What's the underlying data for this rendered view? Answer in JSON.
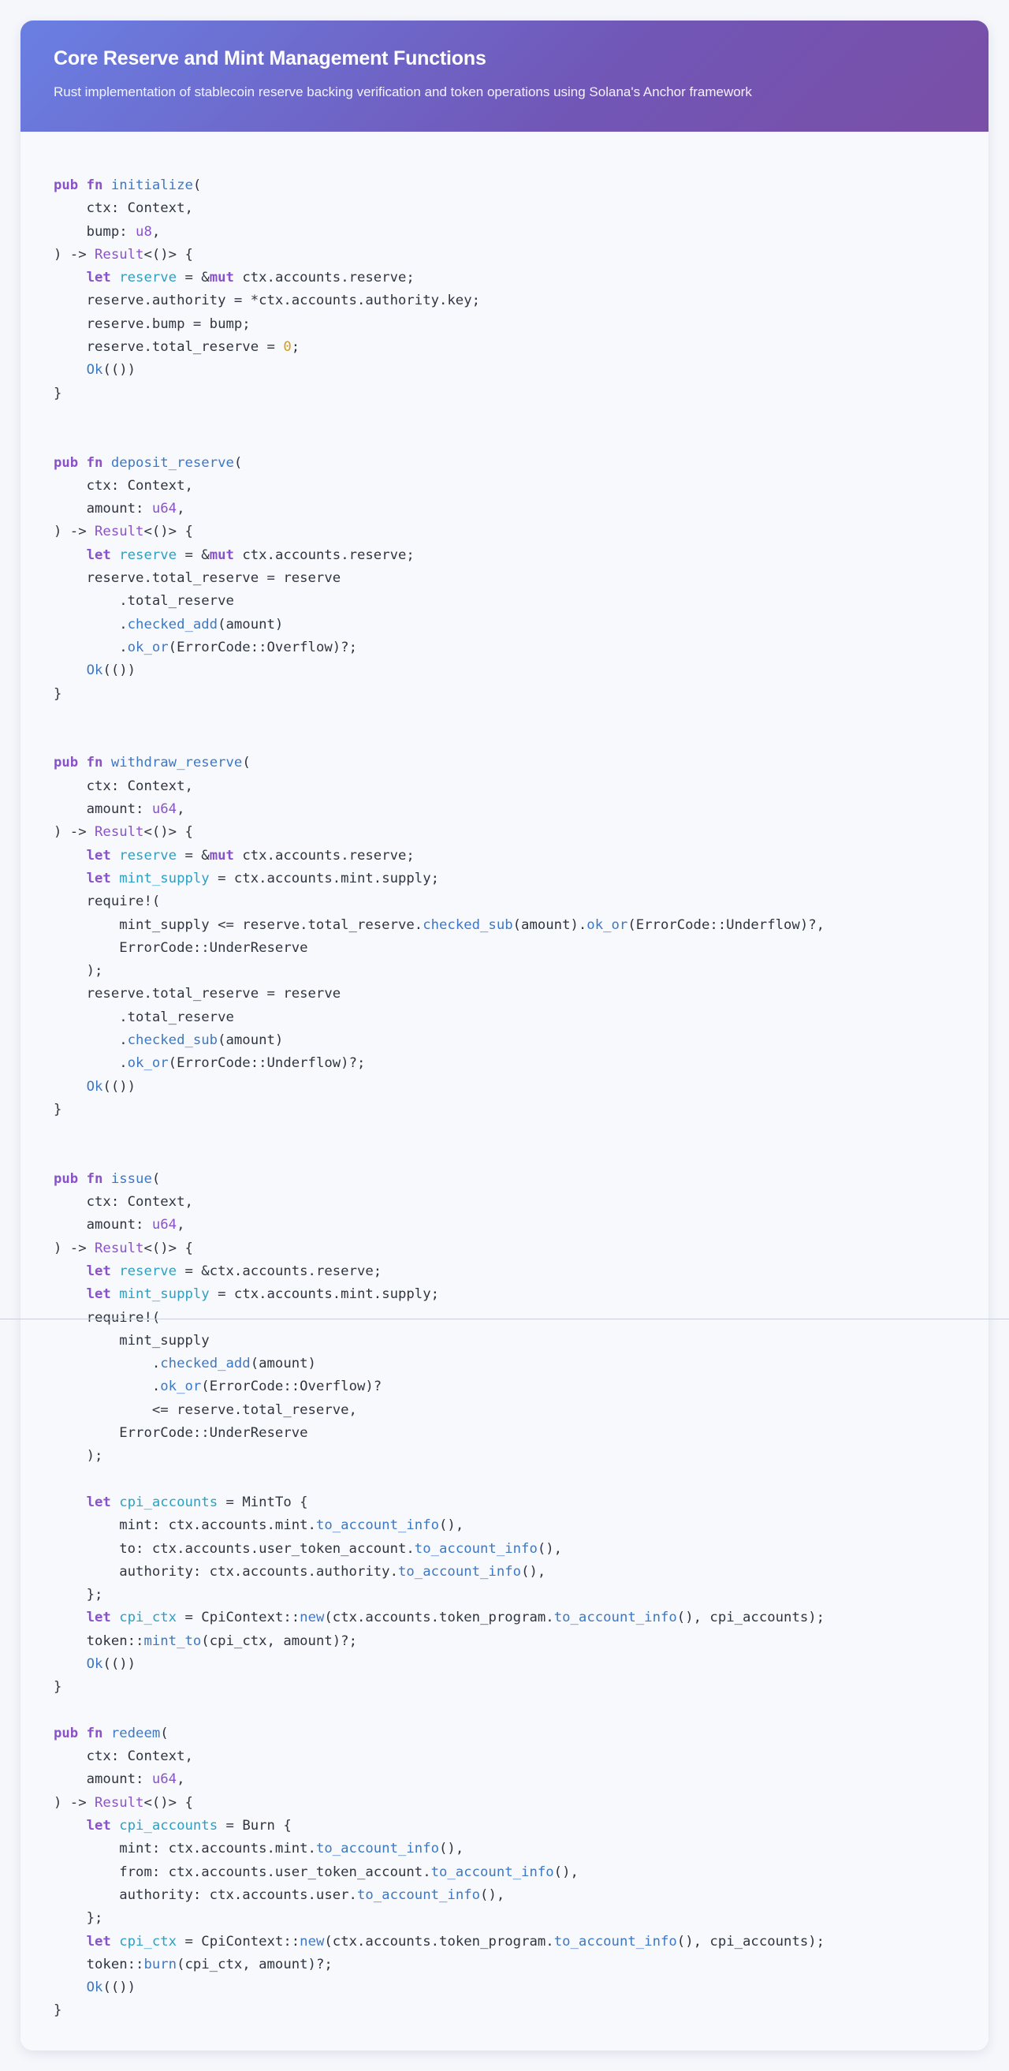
{
  "header": {
    "title": "Core Reserve and Mint Management Functions",
    "subtitle": "Rust implementation of stablecoin reserve backing verification and token operations using Solana's Anchor framework"
  },
  "code": {
    "language": "rust",
    "lines": [
      [
        [
          "kw",
          "pub fn "
        ],
        [
          "fn",
          "initialize"
        ],
        [
          "",
          "("
        ]
      ],
      [
        [
          "",
          "    ctx: Context,"
        ]
      ],
      [
        [
          "",
          "    bump: "
        ],
        [
          "ty",
          "u8"
        ],
        [
          "",
          ","
        ]
      ],
      [
        [
          "",
          ") -> "
        ],
        [
          "ty",
          "Result"
        ],
        [
          "",
          "<()> {"
        ]
      ],
      [
        [
          "",
          "    "
        ],
        [
          "kw",
          "let "
        ],
        [
          "vr",
          "reserve"
        ],
        [
          "",
          " = &"
        ],
        [
          "kw",
          "mut"
        ],
        [
          "",
          " ctx.accounts.reserve;"
        ]
      ],
      [
        [
          "",
          "    reserve.authority = *ctx.accounts.authority.key;"
        ]
      ],
      [
        [
          "",
          "    reserve.bump = bump;"
        ]
      ],
      [
        [
          "",
          "    reserve.total_reserve = "
        ],
        [
          "nu",
          "0"
        ],
        [
          "",
          ";"
        ]
      ],
      [
        [
          "",
          "    "
        ],
        [
          "fn",
          "Ok"
        ],
        [
          "",
          "(())"
        ]
      ],
      [
        [
          "",
          "}"
        ]
      ],
      [],
      [],
      [
        [
          "kw",
          "pub fn "
        ],
        [
          "fn",
          "deposit_reserve"
        ],
        [
          "",
          "("
        ]
      ],
      [
        [
          "",
          "    ctx: Context,"
        ]
      ],
      [
        [
          "",
          "    amount: "
        ],
        [
          "ty",
          "u64"
        ],
        [
          "",
          ","
        ]
      ],
      [
        [
          "",
          ") -> "
        ],
        [
          "ty",
          "Result"
        ],
        [
          "",
          "<()> {"
        ]
      ],
      [
        [
          "",
          "    "
        ],
        [
          "kw",
          "let "
        ],
        [
          "vr",
          "reserve"
        ],
        [
          "",
          " = &"
        ],
        [
          "kw",
          "mut"
        ],
        [
          "",
          " ctx.accounts.reserve;"
        ]
      ],
      [
        [
          "",
          "    reserve.total_reserve = reserve"
        ]
      ],
      [
        [
          "",
          "        .total_reserve"
        ]
      ],
      [
        [
          "",
          "        ."
        ],
        [
          "fn",
          "checked_add"
        ],
        [
          "",
          "(amount)"
        ]
      ],
      [
        [
          "",
          "        ."
        ],
        [
          "fn",
          "ok_or"
        ],
        [
          "",
          "(ErrorCode::Overflow)?;"
        ]
      ],
      [
        [
          "",
          "    "
        ],
        [
          "fn",
          "Ok"
        ],
        [
          "",
          "(())"
        ]
      ],
      [
        [
          "",
          "}"
        ]
      ],
      [],
      [],
      [
        [
          "kw",
          "pub fn "
        ],
        [
          "fn",
          "withdraw_reserve"
        ],
        [
          "",
          "("
        ]
      ],
      [
        [
          "",
          "    ctx: Context,"
        ]
      ],
      [
        [
          "",
          "    amount: "
        ],
        [
          "ty",
          "u64"
        ],
        [
          "",
          ","
        ]
      ],
      [
        [
          "",
          ") -> "
        ],
        [
          "ty",
          "Result"
        ],
        [
          "",
          "<()> {"
        ]
      ],
      [
        [
          "",
          "    "
        ],
        [
          "kw",
          "let "
        ],
        [
          "vr",
          "reserve"
        ],
        [
          "",
          " = &"
        ],
        [
          "kw",
          "mut"
        ],
        [
          "",
          " ctx.accounts.reserve;"
        ]
      ],
      [
        [
          "",
          "    "
        ],
        [
          "kw",
          "let "
        ],
        [
          "vr",
          "mint_supply"
        ],
        [
          "",
          " = ctx.accounts.mint.supply;"
        ]
      ],
      [
        [
          "",
          "    require!("
        ]
      ],
      [
        [
          "",
          "        mint_supply <= reserve.total_reserve."
        ],
        [
          "fn",
          "checked_sub"
        ],
        [
          "",
          "(amount)."
        ],
        [
          "fn",
          "ok_or"
        ],
        [
          "",
          "(ErrorCode::Underflow)?,"
        ]
      ],
      [
        [
          "",
          "        ErrorCode::UnderReserve"
        ]
      ],
      [
        [
          "",
          "    );"
        ]
      ],
      [
        [
          "",
          "    reserve.total_reserve = reserve"
        ]
      ],
      [
        [
          "",
          "        .total_reserve"
        ]
      ],
      [
        [
          "",
          "        ."
        ],
        [
          "fn",
          "checked_sub"
        ],
        [
          "",
          "(amount)"
        ]
      ],
      [
        [
          "",
          "        ."
        ],
        [
          "fn",
          "ok_or"
        ],
        [
          "",
          "(ErrorCode::Underflow)?;"
        ]
      ],
      [
        [
          "",
          "    "
        ],
        [
          "fn",
          "Ok"
        ],
        [
          "",
          "(())"
        ]
      ],
      [
        [
          "",
          "}"
        ]
      ],
      [],
      [],
      [
        [
          "kw",
          "pub fn "
        ],
        [
          "fn",
          "issue"
        ],
        [
          "",
          "("
        ]
      ],
      [
        [
          "",
          "    ctx: Context,"
        ]
      ],
      [
        [
          "",
          "    amount: "
        ],
        [
          "ty",
          "u64"
        ],
        [
          "",
          ","
        ]
      ],
      [
        [
          "",
          ") -> "
        ],
        [
          "ty",
          "Result"
        ],
        [
          "",
          "<()> {"
        ]
      ],
      [
        [
          "",
          "    "
        ],
        [
          "kw",
          "let "
        ],
        [
          "vr",
          "reserve"
        ],
        [
          "",
          " = &ctx.accounts.reserve;"
        ]
      ],
      [
        [
          "",
          "    "
        ],
        [
          "kw",
          "let "
        ],
        [
          "vr",
          "mint_supply"
        ],
        [
          "",
          " = ctx.accounts.mint.supply;"
        ]
      ],
      [
        [
          "",
          "    require!("
        ]
      ],
      [
        [
          "",
          "        mint_supply"
        ]
      ],
      [
        [
          "",
          "            ."
        ],
        [
          "fn",
          "checked_add"
        ],
        [
          "",
          "(amount)"
        ]
      ],
      [
        [
          "",
          "            ."
        ],
        [
          "fn",
          "ok_or"
        ],
        [
          "",
          "(ErrorCode::Overflow)?"
        ]
      ],
      [
        [
          "",
          "            <= reserve.total_reserve,"
        ]
      ],
      [
        [
          "",
          "        ErrorCode::UnderReserve"
        ]
      ],
      [
        [
          "",
          "    );"
        ]
      ],
      [],
      [
        [
          "",
          "    "
        ],
        [
          "kw",
          "let "
        ],
        [
          "vr",
          "cpi_accounts"
        ],
        [
          "",
          " = MintTo {"
        ]
      ],
      [
        [
          "",
          "        mint: ctx.accounts.mint."
        ],
        [
          "fn",
          "to_account_info"
        ],
        [
          "",
          "(),"
        ]
      ],
      [
        [
          "",
          "        to: ctx.accounts.user_token_account."
        ],
        [
          "fn",
          "to_account_info"
        ],
        [
          "",
          "(),"
        ]
      ],
      [
        [
          "",
          "        authority: ctx.accounts.authority."
        ],
        [
          "fn",
          "to_account_info"
        ],
        [
          "",
          "(),"
        ]
      ],
      [
        [
          "",
          "    };"
        ]
      ],
      [
        [
          "",
          "    "
        ],
        [
          "kw",
          "let "
        ],
        [
          "vr",
          "cpi_ctx"
        ],
        [
          "",
          " = CpiContext::"
        ],
        [
          "fn",
          "new"
        ],
        [
          "",
          "(ctx.accounts.token_program."
        ],
        [
          "fn",
          "to_account_info"
        ],
        [
          "",
          "(), cpi_accounts);"
        ]
      ],
      [
        [
          "",
          "    token::"
        ],
        [
          "fn",
          "mint_to"
        ],
        [
          "",
          "(cpi_ctx, amount)?;"
        ]
      ],
      [
        [
          "",
          "    "
        ],
        [
          "fn",
          "Ok"
        ],
        [
          "",
          "(())"
        ]
      ],
      [
        [
          "",
          "}"
        ]
      ],
      [],
      [
        [
          "kw",
          "pub fn "
        ],
        [
          "fn",
          "redeem"
        ],
        [
          "",
          "("
        ]
      ],
      [
        [
          "",
          "    ctx: Context,"
        ]
      ],
      [
        [
          "",
          "    amount: "
        ],
        [
          "ty",
          "u64"
        ],
        [
          "",
          ","
        ]
      ],
      [
        [
          "",
          ") -> "
        ],
        [
          "ty",
          "Result"
        ],
        [
          "",
          "<()> {"
        ]
      ],
      [
        [
          "",
          "    "
        ],
        [
          "kw",
          "let "
        ],
        [
          "vr",
          "cpi_accounts"
        ],
        [
          "",
          " = Burn {"
        ]
      ],
      [
        [
          "",
          "        mint: ctx.accounts.mint."
        ],
        [
          "fn",
          "to_account_info"
        ],
        [
          "",
          "(),"
        ]
      ],
      [
        [
          "",
          "        from: ctx.accounts.user_token_account."
        ],
        [
          "fn",
          "to_account_info"
        ],
        [
          "",
          "(),"
        ]
      ],
      [
        [
          "",
          "        authority: ctx.accounts.user."
        ],
        [
          "fn",
          "to_account_info"
        ],
        [
          "",
          "(),"
        ]
      ],
      [
        [
          "",
          "    };"
        ]
      ],
      [
        [
          "",
          "    "
        ],
        [
          "kw",
          "let "
        ],
        [
          "vr",
          "cpi_ctx"
        ],
        [
          "",
          " = CpiContext::"
        ],
        [
          "fn",
          "new"
        ],
        [
          "",
          "(ctx.accounts.token_program."
        ],
        [
          "fn",
          "to_account_info"
        ],
        [
          "",
          "(), cpi_accounts);"
        ]
      ],
      [
        [
          "",
          "    token::"
        ],
        [
          "fn",
          "burn"
        ],
        [
          "",
          "(cpi_ctx, amount)?;"
        ]
      ],
      [
        [
          "",
          "    "
        ],
        [
          "fn",
          "Ok"
        ],
        [
          "",
          "(())"
        ]
      ],
      [
        [
          "",
          "}"
        ]
      ]
    ]
  }
}
